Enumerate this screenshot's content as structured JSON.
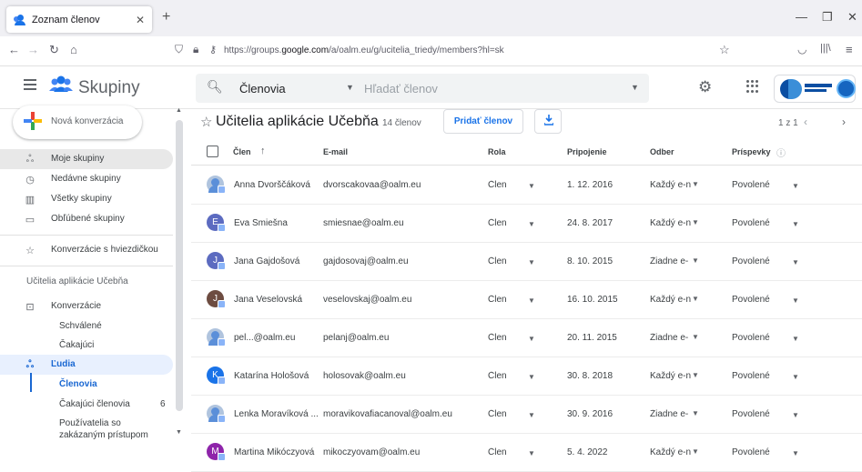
{
  "browser": {
    "tab_title": "Zoznam členov",
    "url_prefix": "https://groups.",
    "url_domain": "google.com",
    "url_suffix": "/a/oalm.eu/g/ucitelia_triedy/members?hl=sk"
  },
  "app": {
    "name": "Skupiny",
    "search_scope": "Členovia",
    "search_placeholder": "Hľadať členov"
  },
  "sidebar": {
    "compose_label": "Nová konverzácia",
    "items": [
      {
        "icon": "groups-icon",
        "label": "Moje skupiny"
      },
      {
        "icon": "clock-icon",
        "label": "Nedávne skupiny"
      },
      {
        "icon": "building-icon",
        "label": "Všetky skupiny"
      },
      {
        "icon": "folder-icon",
        "label": "Obľúbené skupiny"
      },
      {
        "icon": "star-icon",
        "label": "Konverzácie s hviezdičkou"
      }
    ],
    "group_name": "Učitelia aplikácie Učebňa",
    "conversations_label": "Konverzácie",
    "approved_label": "Schválené",
    "pending_label": "Čakajúci",
    "people_label": "Ľudia",
    "members_label": "Členovia",
    "pending_members_label": "Čakajúci členovia",
    "pending_members_count": "6",
    "banned_label_1": "Používatelia so",
    "banned_label_2": "zakázaným prístupom"
  },
  "main": {
    "title": "Učitelia aplikácie Učebňa",
    "member_count": "14 členov",
    "add_members": "Pridať členov",
    "pager": "1 z 1"
  },
  "table": {
    "headers": {
      "member": "Člen",
      "sort_icon": "↑",
      "email": "E-mail",
      "role": "Rola",
      "joined": "Pripojenie",
      "subscription": "Odber",
      "posting": "Príspevky",
      "info_icon": "ⓘ"
    },
    "rows": [
      {
        "avatar": "",
        "avatar_color": "#b0c4de",
        "name": "Anna Dvorščáková",
        "email": "dvorscakovaa@oalm.eu",
        "role": "Člen",
        "joined": "1. 12. 2016",
        "subscription": "Každý e-n",
        "posting": "Povolené"
      },
      {
        "avatar": "E",
        "avatar_color": "#5c6bc0",
        "name": "Eva Smiešna",
        "email": "smiesnae@oalm.eu",
        "role": "Člen",
        "joined": "24. 8. 2017",
        "subscription": "Každý e-n",
        "posting": "Povolené"
      },
      {
        "avatar": "J",
        "avatar_color": "#5c6bc0",
        "name": "Jana Gajdošová",
        "email": "gajdosovaj@oalm.eu",
        "role": "Člen",
        "joined": "8. 10. 2015",
        "subscription": "Žiadne e-",
        "posting": "Povolené"
      },
      {
        "avatar": "J",
        "avatar_color": "#6d4c41",
        "name": "Jana Veselovská",
        "email": "veselovskaj@oalm.eu",
        "role": "Člen",
        "joined": "16. 10. 2015",
        "subscription": "Každý e-n",
        "posting": "Povolené"
      },
      {
        "avatar": "",
        "avatar_color": "#b0c4de",
        "name": "pel...@oalm.eu",
        "email": "pelanj@oalm.eu",
        "role": "Člen",
        "joined": "20. 11. 2015",
        "subscription": "Žiadne e-",
        "posting": "Povolené"
      },
      {
        "avatar": "K",
        "avatar_color": "#1a73e8",
        "name": "Katarína Hološová",
        "email": "holosovak@oalm.eu",
        "role": "Člen",
        "joined": "30. 8. 2018",
        "subscription": "Každý e-n",
        "posting": "Povolené"
      },
      {
        "avatar": "",
        "avatar_color": "#b0c4de",
        "name": "Lenka Moravíková ...",
        "email": "moravikovafiacanoval@oalm.eu",
        "role": "Člen",
        "joined": "30. 9. 2016",
        "subscription": "Žiadne e-",
        "posting": "Povolené"
      },
      {
        "avatar": "M",
        "avatar_color": "#8e24aa",
        "name": "Martina Mikóczyová",
        "email": "mikoczyovam@oalm.eu",
        "role": "Člen",
        "joined": "5. 4. 2022",
        "subscription": "Každý e-n",
        "posting": "Povolené"
      }
    ]
  },
  "colors": {
    "accent": "#1a73e8",
    "active_bg": "#e8f0fe",
    "selected_bg": "#e8e8e8"
  }
}
